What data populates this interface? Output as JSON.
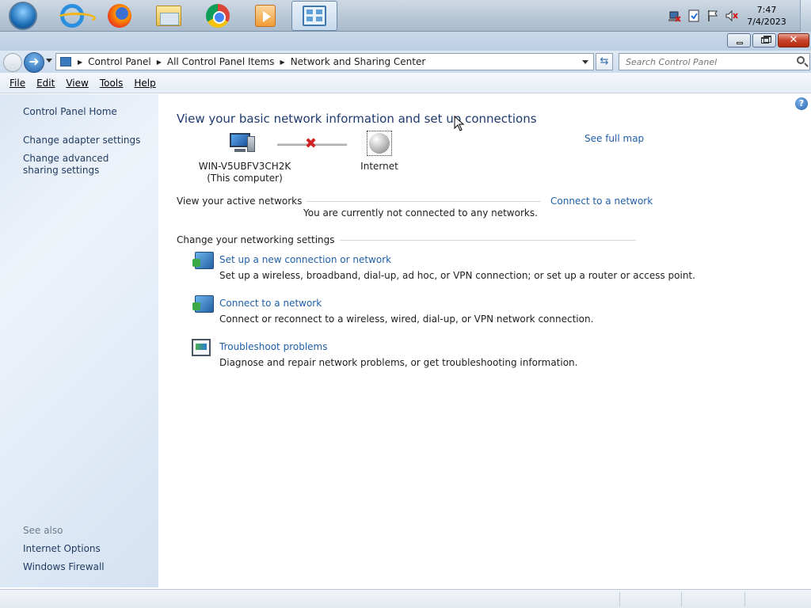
{
  "taskbar": {
    "pinned": [
      {
        "name": "start-button",
        "icon": "windows-orb-icon"
      },
      {
        "name": "internet-explorer",
        "icon": "internet-explorer-icon"
      },
      {
        "name": "firefox",
        "icon": "firefox-icon"
      },
      {
        "name": "windows-explorer",
        "icon": "folder-icon"
      },
      {
        "name": "chrome",
        "icon": "chrome-icon"
      },
      {
        "name": "media-player",
        "icon": "media-player-icon"
      },
      {
        "name": "control-panel",
        "icon": "control-panel-icon",
        "active": true
      }
    ],
    "tray_icons": [
      "network-disconnected-icon",
      "action-center-icon",
      "flag-icon",
      "volume-muted-icon"
    ],
    "clock": {
      "time": "7:47",
      "date": "7/4/2023"
    }
  },
  "window": {
    "buttons": {
      "minimize": "minimize",
      "maximize": "restore",
      "close": "✕"
    }
  },
  "address": {
    "crumbs": [
      "Control Panel",
      "All Control Panel Items",
      "Network and Sharing Center"
    ],
    "search_placeholder": "Search Control Panel"
  },
  "menu": [
    "File",
    "Edit",
    "View",
    "Tools",
    "Help"
  ],
  "sidebar": {
    "home": "Control Panel Home",
    "links": [
      "Change adapter settings",
      "Change advanced sharing settings"
    ],
    "see_also_label": "See also",
    "see_also": [
      "Internet Options",
      "Windows Firewall"
    ]
  },
  "main": {
    "heading": "View your basic network information and set up connections",
    "see_full_map": "See full map",
    "computer_name": "WIN-V5UBFV3CH2K",
    "computer_sub": "(This computer)",
    "internet_label": "Internet",
    "active_networks_label": "View your active networks",
    "connect_link": "Connect to a network",
    "not_connected": "You are currently not connected to any networks.",
    "change_settings_label": "Change your networking settings",
    "tasks": [
      {
        "title": "Set up a new connection or network",
        "desc": "Set up a wireless, broadband, dial-up, ad hoc, or VPN connection; or set up a router or access point.",
        "icon": "new-connection-icon"
      },
      {
        "title": "Connect to a network",
        "desc": "Connect or reconnect to a wireless, wired, dial-up, or VPN network connection.",
        "icon": "connect-network-icon"
      },
      {
        "title": "Troubleshoot problems",
        "desc": "Diagnose and repair network problems, or get troubleshooting information.",
        "icon": "troubleshoot-icon"
      }
    ]
  },
  "colors": {
    "link": "#1f5fa8",
    "heading": "#1e3a6e",
    "error": "#d02020"
  }
}
